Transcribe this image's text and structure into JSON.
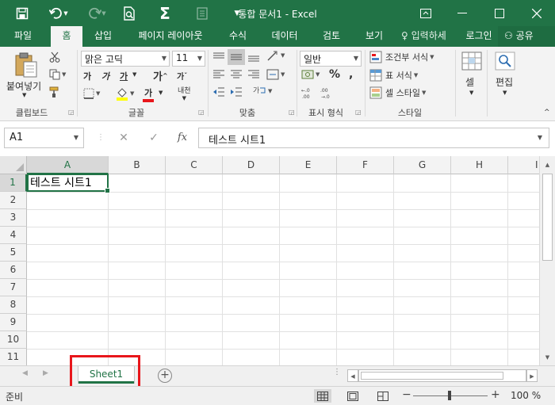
{
  "titlebar": {
    "title": "통합 문서1 - Excel",
    "qa_icons": [
      "save-icon",
      "undo-icon",
      "redo-icon",
      "print-preview-icon",
      "autosum-icon",
      "form-icon",
      "customize-icon"
    ]
  },
  "tabs": [
    "파일",
    "홈",
    "삽입",
    "페이지 레이아웃",
    "수식",
    "데이터",
    "검토",
    "보기"
  ],
  "active_tab": "홈",
  "tellme": "입력하세",
  "signin": "로그인",
  "share": "공유",
  "ribbon": {
    "clipboard": {
      "label": "클립보드",
      "paste": "붙여넣기"
    },
    "font": {
      "label": "글꼴",
      "font_name": "맑은 고딕",
      "font_size": "11",
      "bold": "가",
      "italic": "가",
      "underline": "가",
      "grow": "가",
      "shrink": "가",
      "color_letter": "가",
      "phonetic": "내천"
    },
    "alignment": {
      "label": "맞춤"
    },
    "number": {
      "label": "표시 형식",
      "format": "일반"
    },
    "styles": {
      "label": "스타일",
      "conditional": "조건부 서식",
      "format_table": "표 서식",
      "cell_styles": "셀 스타일"
    },
    "cells": {
      "label": "셀"
    },
    "editing": {
      "label": "편집"
    }
  },
  "formula_bar": {
    "name_box": "A1",
    "fx": "fx",
    "value": "테스트 시트1"
  },
  "grid": {
    "columns": [
      "A",
      "B",
      "C",
      "D",
      "E",
      "F",
      "G",
      "H",
      "I"
    ],
    "rows": [
      "1",
      "2",
      "3",
      "4",
      "5",
      "6",
      "7",
      "8",
      "9",
      "10",
      "11"
    ],
    "selected_cell": "A1",
    "a1_value": "테스트 시트1"
  },
  "sheets": [
    "Sheet1"
  ],
  "status": {
    "text": "준비",
    "zoom": "100 %"
  },
  "colors": {
    "accent": "#217346",
    "highlight": "#e8161b"
  }
}
